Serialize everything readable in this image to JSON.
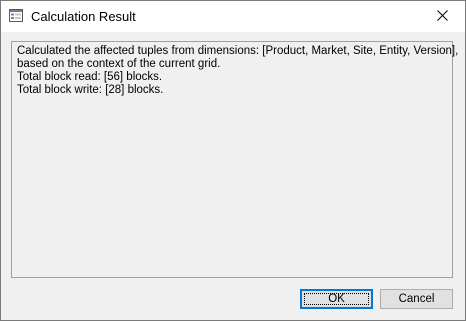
{
  "window": {
    "title": "Calculation Result"
  },
  "icons": {
    "app": "window-app-icon",
    "close": "close-icon"
  },
  "message": {
    "lines": [
      "Calculated the affected tuples from dimensions: [Product, Market, Site, Entity, Version],",
      "based on the context of the current grid.",
      "Total block read: [56] blocks.",
      "Total block write: [28] blocks."
    ]
  },
  "buttons": {
    "ok_label": "OK",
    "cancel_label": "Cancel"
  },
  "colors": {
    "focus_accent": "#0078d7",
    "dialog_background": "#f0f0f0",
    "titlebar_background": "#ffffff"
  }
}
